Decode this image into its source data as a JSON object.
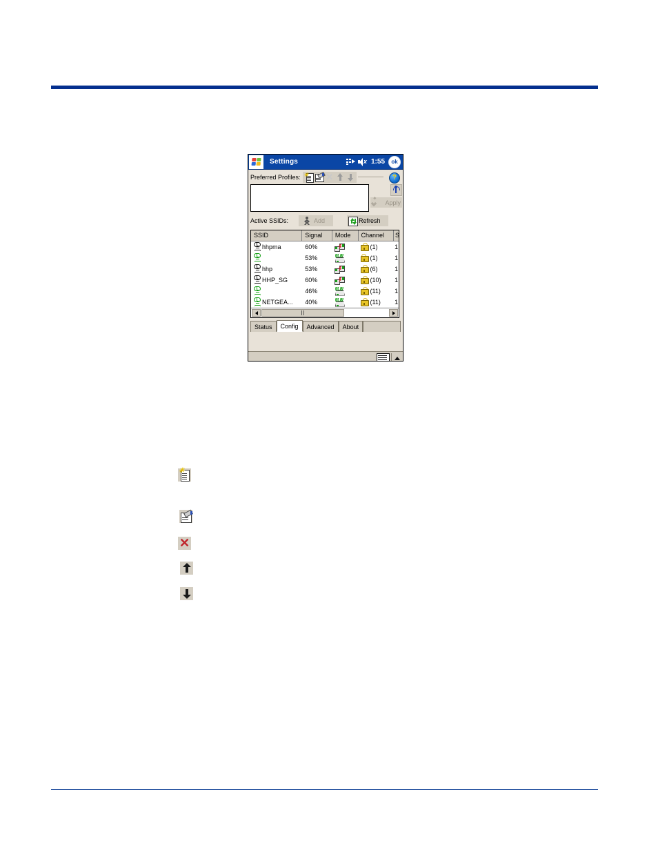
{
  "page": {
    "rule_color_top": "#042f8e",
    "rule_color_bottom": "#1b4a9c"
  },
  "pda": {
    "titlebar": {
      "app_title": "Settings",
      "clock": "1:55",
      "ok_label": "ok",
      "icons": [
        "connectivity-icon",
        "volume-muted-icon",
        "ok-button"
      ]
    },
    "preferred_profiles": {
      "label": "Preferred Profiles:",
      "tools": [
        {
          "name": "new-profile-icon",
          "title": "New"
        },
        {
          "name": "edit-profile-icon",
          "title": "Edit"
        },
        {
          "name": "delete-profile-icon",
          "title": "Delete"
        },
        {
          "name": "move-up-icon",
          "title": "Move Up"
        },
        {
          "name": "move-down-icon",
          "title": "Move Down"
        }
      ],
      "help_icon": "help-icon",
      "list_values": []
    },
    "side_buttons": {
      "rf_icon": "rf-signal-icon",
      "apply_label": "Apply",
      "apply_enabled": false
    },
    "active_ssids": {
      "label": "Active SSIDs:",
      "add_label": "Add",
      "add_enabled": false,
      "refresh_label": "Refresh"
    },
    "table": {
      "columns": [
        "SSID",
        "Signal",
        "Mode",
        "Channel",
        "S"
      ],
      "rows": [
        {
          "ssid": "hhpma",
          "antenna": "black",
          "signal": "60%",
          "mode": "ad-hoc",
          "lock": "open",
          "channel": "(1)",
          "sec": "1"
        },
        {
          "ssid": "",
          "antenna": "green",
          "signal": "53%",
          "mode": "infrastructure",
          "lock": "closed",
          "channel": "(1)",
          "sec": "1"
        },
        {
          "ssid": "hhp",
          "antenna": "black",
          "signal": "53%",
          "mode": "ad-hoc",
          "lock": "open",
          "channel": "(6)",
          "sec": "1"
        },
        {
          "ssid": "HHP_SG",
          "antenna": "black",
          "signal": "60%",
          "mode": "ad-hoc",
          "lock": "open",
          "channel": "(10)",
          "sec": "1"
        },
        {
          "ssid": "",
          "antenna": "green",
          "signal": "46%",
          "mode": "infrastructure",
          "lock": "open",
          "channel": "(11)",
          "sec": "1"
        },
        {
          "ssid": "NETGEA...",
          "antenna": "green",
          "signal": "40%",
          "mode": "infrastructure",
          "lock": "open",
          "channel": "(11)",
          "sec": "1"
        }
      ],
      "hscroll": {
        "left_arrow": "scroll-left-icon",
        "right_arrow": "scroll-right-icon"
      }
    },
    "tabs": [
      {
        "label": "Status",
        "active": false
      },
      {
        "label": "Config",
        "active": true
      },
      {
        "label": "Advanced",
        "active": false
      },
      {
        "label": "About",
        "active": false
      }
    ],
    "sip": {
      "keyboard_icon": "keyboard-icon",
      "chevron_icon": "chevron-up-icon"
    }
  },
  "legend_icons": [
    {
      "name": "new-profile-icon"
    },
    {
      "name": "edit-profile-icon"
    },
    {
      "name": "delete-profile-icon"
    },
    {
      "name": "move-up-icon"
    },
    {
      "name": "move-down-icon"
    }
  ]
}
